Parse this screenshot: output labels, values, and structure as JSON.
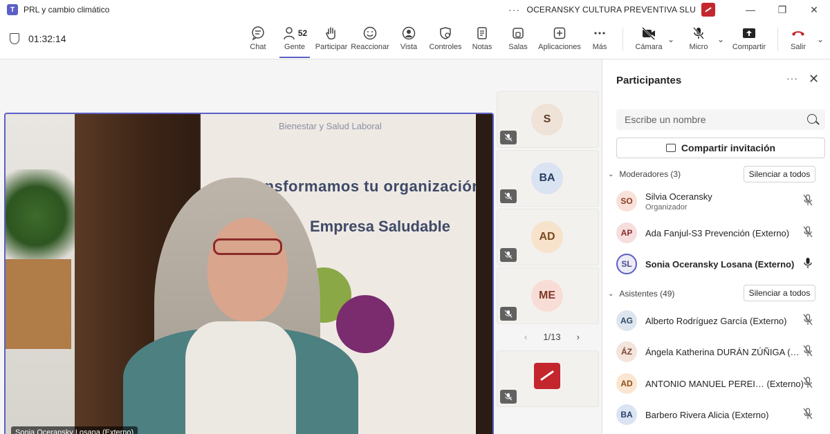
{
  "window": {
    "app_icon": "teams-icon",
    "title": "PRL y cambio climático",
    "more": "···",
    "org_name": "OCERANSKY CULTURA PREVENTIVA SLU",
    "minimize": "—",
    "restore": "❐",
    "close": "✕"
  },
  "toolbar": {
    "timer": "01:32:14",
    "chat": "Chat",
    "people": "Gente",
    "people_count": "52",
    "participate": "Participar",
    "react": "Reaccionar",
    "view": "Vista",
    "controls": "Controles",
    "notes": "Notas",
    "rooms": "Salas",
    "apps": "Aplicaciones",
    "more": "Más",
    "camera": "Cámara",
    "mic": "Micro",
    "share": "Compartir",
    "leave": "Salir"
  },
  "stage": {
    "main_speaker": "Sonia Oceransky Losana (Externo)",
    "banner_line1": "Bienestar y Salud Laboral",
    "banner_line2": "Transformamos tu organización",
    "banner_line3": "Empresa Saludable",
    "tiles": [
      {
        "initials": "S"
      },
      {
        "initials": "BA"
      },
      {
        "initials": "AD"
      },
      {
        "initials": "ME"
      }
    ],
    "pager": "1/13"
  },
  "panel": {
    "title": "Participantes",
    "search_placeholder": "Escribe un nombre",
    "share_invite": "Compartir invitación",
    "moderators_label": "Moderadores (3)",
    "attendees_label": "Asistentes (49)",
    "mute_all": "Silenciar a todos",
    "moderators": [
      {
        "initials": "SO",
        "name": "Silvia Oceransky",
        "role": "Organizador",
        "bg": "#f8e1d9",
        "fg": "#8a3c22"
      },
      {
        "initials": "AP",
        "name": "Ada Fanjul-S3 Prevención (Externo)",
        "bg": "#f6dede",
        "fg": "#8a2b2b"
      },
      {
        "initials": "SL",
        "name": "Sonia Oceransky Losana (Externo)",
        "bg": "#ecebf7",
        "fg": "#4a4a8a"
      }
    ],
    "attendees": [
      {
        "initials": "AG",
        "name": "Alberto Rodríguez García (Externo)",
        "bg": "#dde6ee",
        "fg": "#2e4b63"
      },
      {
        "initials": "ÁZ",
        "name": "Ángela Katherina DURÁN ZÚÑIGA (…",
        "bg": "#f3e4dc",
        "fg": "#7a4430"
      },
      {
        "initials": "AD",
        "name": "ANTONIO MANUEL PEREI…  (Externo)",
        "bg": "#fbe6d2",
        "fg": "#8a4e1c"
      },
      {
        "initials": "BA",
        "name": "Barbero Rivera Alicia (Externo)",
        "bg": "#dbe4f3",
        "fg": "#2a3e66"
      }
    ]
  }
}
